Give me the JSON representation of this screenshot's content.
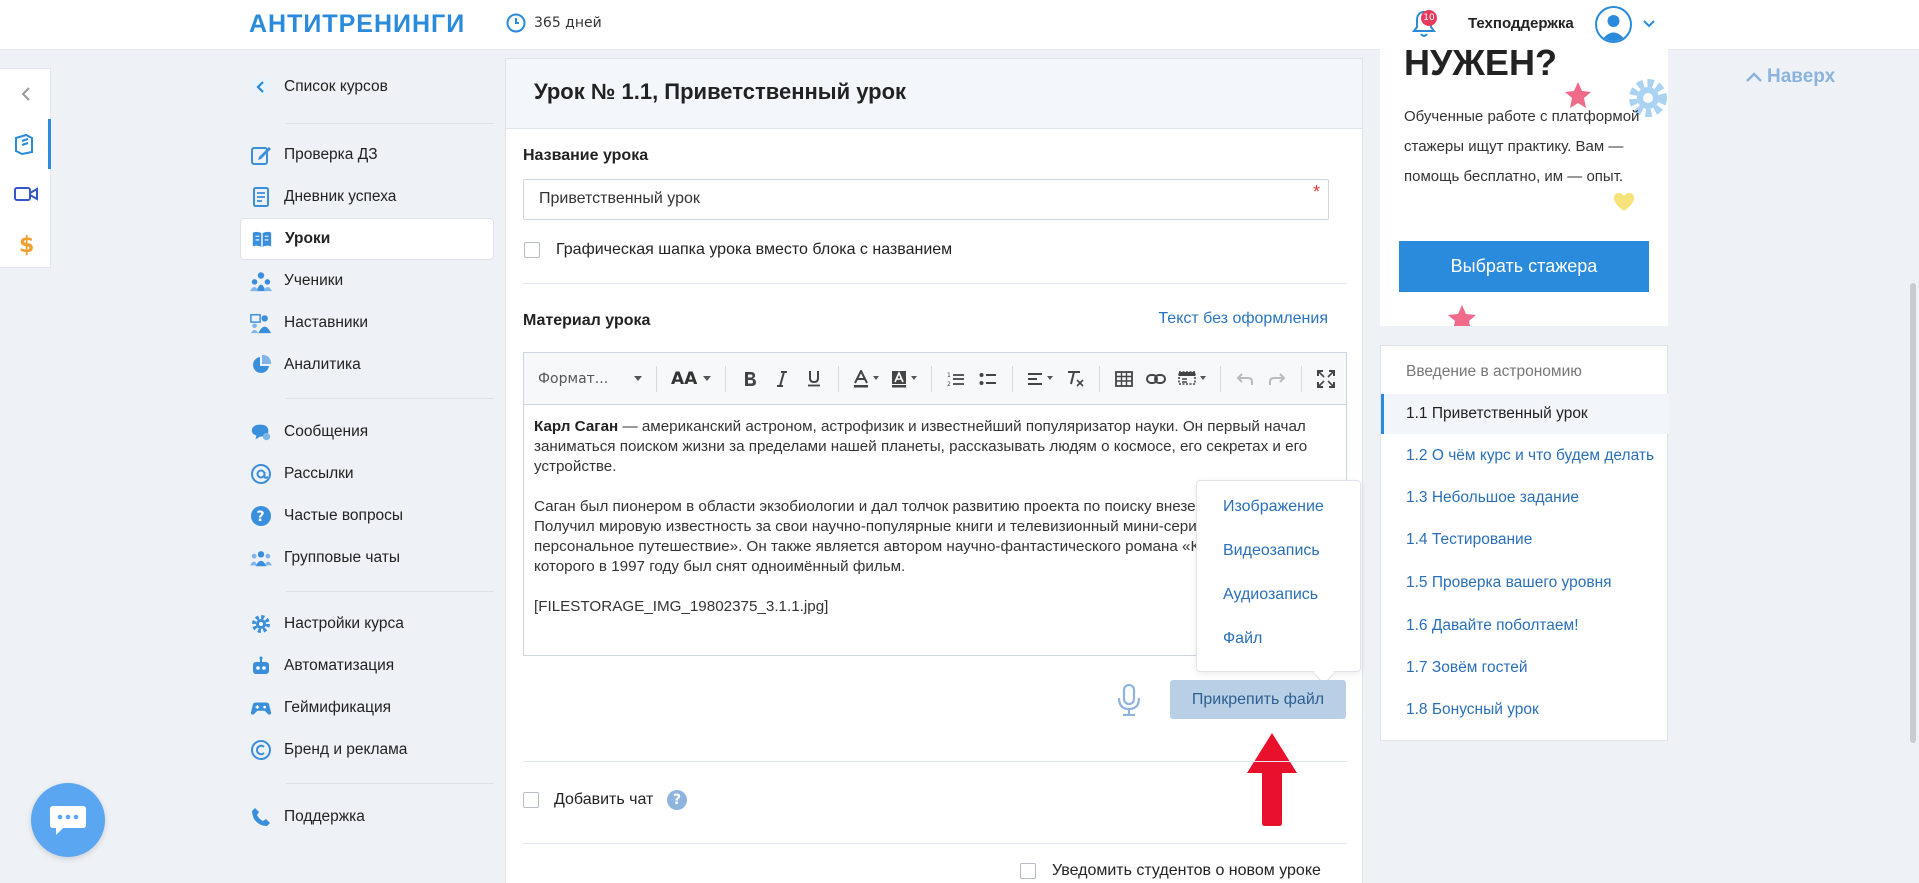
{
  "header": {
    "logo": "АНТИТРЕНИНГИ",
    "days": "365 дней",
    "notifications_count": "10",
    "support_label": "Техподдержка"
  },
  "nav": {
    "items": [
      {
        "label": "Список курсов",
        "icon": "back-circle-icon"
      },
      {
        "label": "Проверка ДЗ",
        "icon": "edit-icon"
      },
      {
        "label": "Дневник успеха",
        "icon": "diary-icon"
      },
      {
        "label": "Уроки",
        "icon": "book-icon",
        "active": true
      },
      {
        "label": "Ученики",
        "icon": "students-icon"
      },
      {
        "label": "Наставники",
        "icon": "mentors-icon"
      },
      {
        "label": "Аналитика",
        "icon": "pie-chart-icon"
      },
      {
        "label": "Сообщения",
        "icon": "messages-icon"
      },
      {
        "label": "Рассылки",
        "icon": "at-icon"
      },
      {
        "label": "Частые вопросы",
        "icon": "question-icon"
      },
      {
        "label": "Групповые чаты",
        "icon": "group-icon"
      },
      {
        "label": "Настройки курса",
        "icon": "gear-icon"
      },
      {
        "label": "Автоматизация",
        "icon": "robot-icon"
      },
      {
        "label": "Геймификация",
        "icon": "gamepad-icon"
      },
      {
        "label": "Бренд и реклама",
        "icon": "copyright-icon"
      },
      {
        "label": "Поддержка",
        "icon": "phone-icon"
      }
    ]
  },
  "main": {
    "title": "Урок № 1.1, Приветственный урок",
    "lesson_name_label": "Название урока",
    "lesson_name_value": "Приветственный урок",
    "required_mark": "*",
    "graphic_header_label": "Графическая шапка урока вместо блока с названием",
    "material_label": "Материал урока",
    "plain_text_link": "Текст без оформления",
    "toolbar": {
      "format": "Формат...",
      "font_size": "AA"
    },
    "content": {
      "p1_bold": "Карл Саган",
      "p1_rest": " — американский астроном, астрофизик и известнейший популяризатор науки. Он первый начал заниматься поиском жизни за пределами нашей планеты, рассказывать людям о космосе, его секретах и его устройстве.",
      "p2": "Саган был пионером в области экзобиологии и дал толчок развитию проекта по поиску внеземного разума SETI. Получил мировую известность за свои научно-популярные книги и телевизионный мини-сериал «Космос: персональное путешествие». Он также является автором научно-фантастического романа «Контакт», на основе которого в 1997 году был снят одноимённый фильм.",
      "p3": "[FILESTORAGE_IMG_19802375_3.1.1.jpg]"
    },
    "attach_menu": [
      "Изображение",
      "Видеозапись",
      "Аудиозапись",
      "Файл"
    ],
    "attach_button": "Прикрепить файл",
    "add_chat_label": "Добавить чат",
    "help_glyph": "?",
    "notify_label": "Уведомить студентов о новом уроке"
  },
  "promo": {
    "title": "НУЖЕН?",
    "text": "Обученные работе с платформой стажеры ищут практику. Вам — помощь бесплатно, им — опыт.",
    "button": "Выбрать стажера"
  },
  "to_top": "Наверх",
  "lessons": {
    "heading": "Введение в астрономию",
    "items": [
      {
        "label": "1.1 Приветственный урок",
        "active": true
      },
      {
        "label": "1.2 О чём курс и что будем делать"
      },
      {
        "label": "1.3 Небольшое задание"
      },
      {
        "label": "1.4 Тестирование"
      },
      {
        "label": "1.5 Проверка вашего уровня"
      },
      {
        "label": "1.6 Давайте поболтаем!"
      },
      {
        "label": "1.7 Зовём гостей"
      },
      {
        "label": "1.8 Бонусный урок"
      }
    ]
  },
  "colors": {
    "accent": "#2a8bdc",
    "link": "#2a6fb8",
    "badge": "#e83a5c",
    "arrow": "#e8102a"
  }
}
